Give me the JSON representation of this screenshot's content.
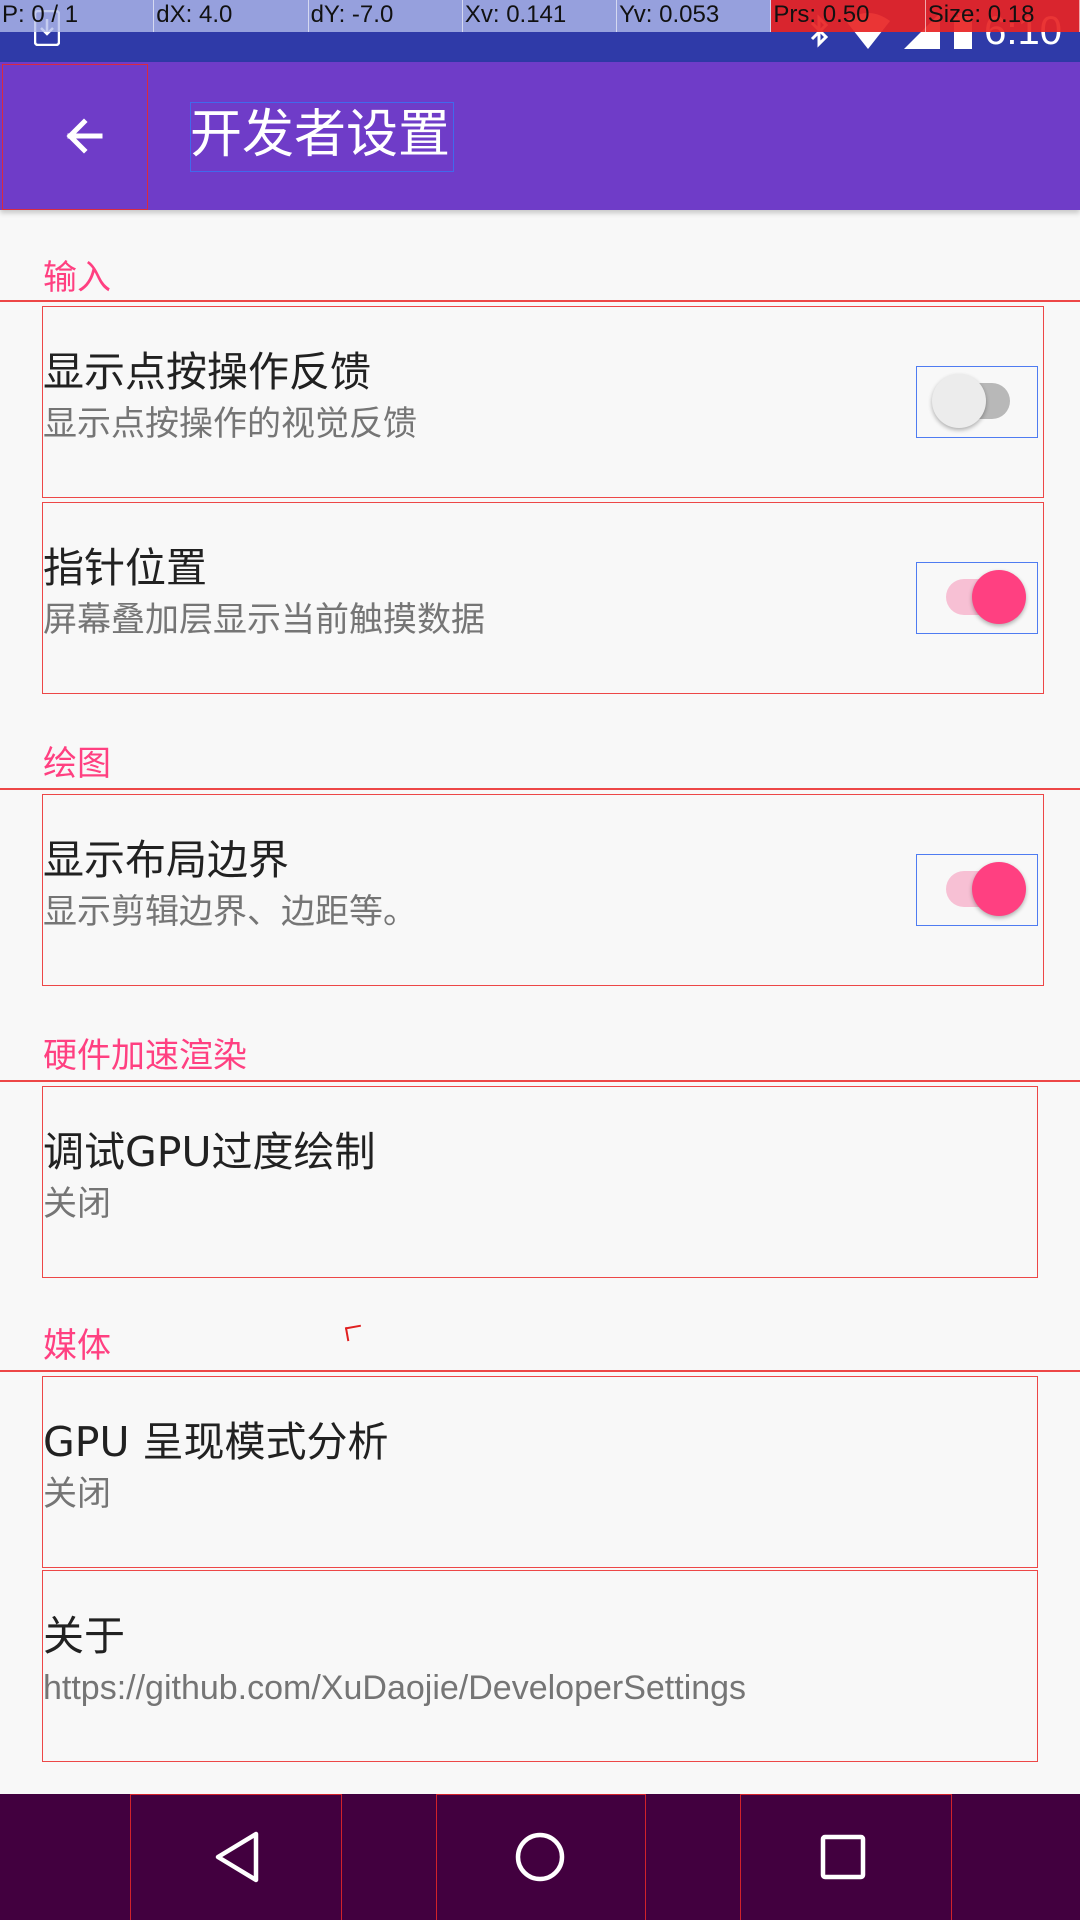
{
  "status_bar": {
    "time": "6:10",
    "download_icon": "download-icon",
    "bluetooth_icon": "bluetooth-icon",
    "wifi_icon": "wifi-icon",
    "signal_icon": "signal-icon",
    "battery_icon": "battery-icon"
  },
  "pointer_overlay": {
    "pointer": "P: 0 / 1",
    "dx": "dX: 4.0",
    "dy": "dY: -7.0",
    "xv": "Xv: 0.141",
    "yv": "Yv: 0.053",
    "prs": "Prs: 0.50",
    "size": "Size: 0.18"
  },
  "app_bar": {
    "title": "开发者设置",
    "back_icon": "arrow-back-icon",
    "color": "#6f3cc8"
  },
  "categories": {
    "input": "输入",
    "drawing": "绘图",
    "hw_render": "硬件加速渲染",
    "media": "媒体"
  },
  "prefs": {
    "show_touches": {
      "title": "显示点按操作反馈",
      "summary": "显示点按操作的视觉反馈",
      "checked": false
    },
    "pointer_location": {
      "title": "指针位置",
      "summary": "屏幕叠加层显示当前触摸数据",
      "checked": true
    },
    "layout_bounds": {
      "title": "显示布局边界",
      "summary": "显示剪辑边界、边距等。",
      "checked": true
    },
    "gpu_overdraw": {
      "title": "调试GPU过度绘制",
      "summary": "关闭"
    },
    "gpu_profile": {
      "title": "GPU 呈现模式分析",
      "summary": "关闭"
    },
    "about": {
      "title": "关于",
      "summary": "https://github.com/XuDaojie/DeveloperSettings"
    }
  },
  "nav_bar": {
    "back_icon": "nav-back-icon",
    "home_icon": "nav-home-icon",
    "recents_icon": "nav-recents-icon",
    "color": "#42003f"
  },
  "colors": {
    "accent": "#ff4081",
    "status_bar": "#2f3aa8"
  }
}
